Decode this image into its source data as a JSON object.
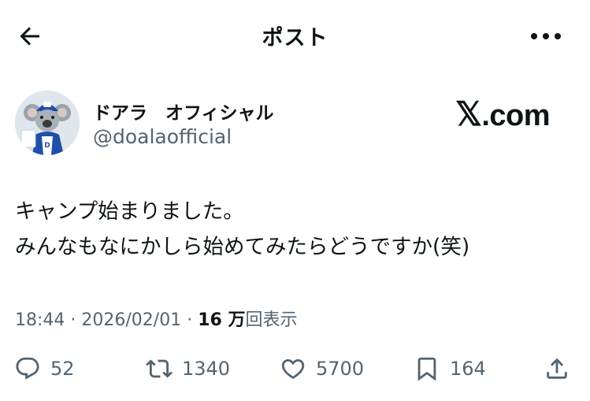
{
  "header": {
    "title": "ポスト",
    "back_icon": "arrow-left-icon",
    "more_icon": "more-horizontal-icon"
  },
  "author": {
    "display_name": "ドアラ　オフィシャル",
    "handle": "@doalaofficial",
    "avatar_icon": "koala-mascot-avatar"
  },
  "site_logo": {
    "mark": "𝕏",
    "suffix": ".com"
  },
  "post": {
    "lines": [
      "キャンプ始まりました。",
      "みんなもなにかしら始めてみたらどうですか(笑)"
    ]
  },
  "meta": {
    "time": "18:44",
    "separator": " · ",
    "date": "2026/02/01",
    "views_count": "16 万",
    "views_label": "回表示"
  },
  "actions": {
    "reply": "52",
    "repost": "1340",
    "like": "5700",
    "bookmark": "164"
  },
  "colors": {
    "text": "#0f1419",
    "secondary": "#536471",
    "background": "#ffffff"
  }
}
